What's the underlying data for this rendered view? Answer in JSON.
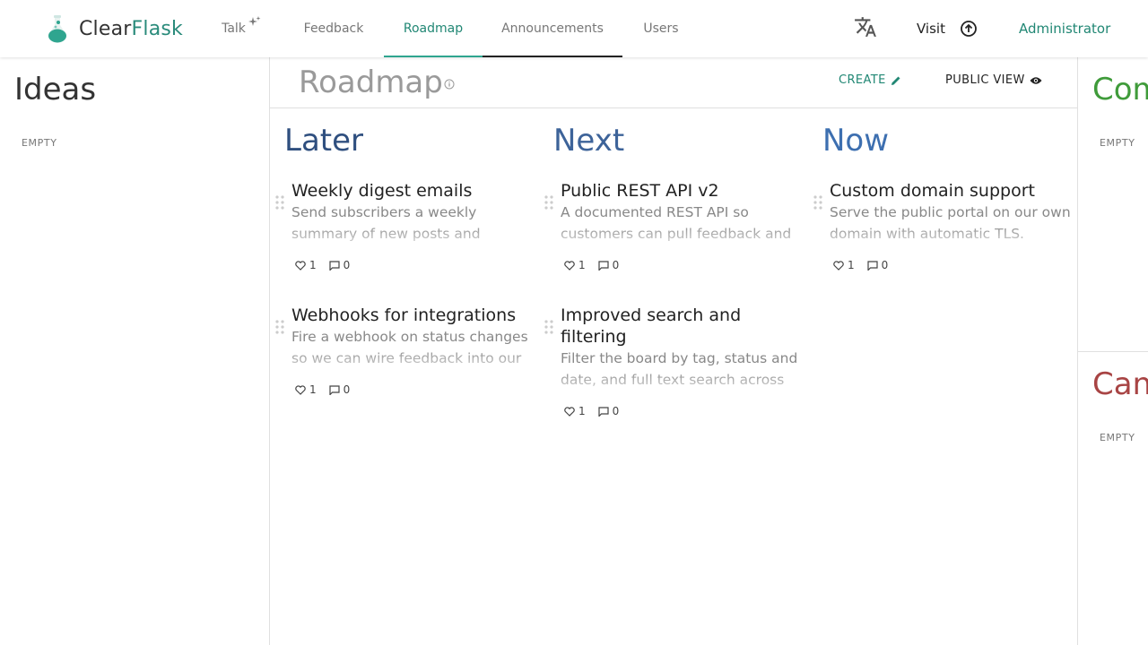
{
  "brand": {
    "part1": "Clear",
    "part2": "Flask"
  },
  "nav": {
    "tabs": [
      {
        "label": "Talk"
      },
      {
        "label": "Feedback"
      },
      {
        "label": "Roadmap"
      },
      {
        "label": "Announcements"
      },
      {
        "label": "Users"
      }
    ],
    "active": "Roadmap",
    "visit_label": "Visit",
    "account_label": "Administrator"
  },
  "ideas": {
    "title": "Ideas",
    "empty": "EMPTY"
  },
  "board": {
    "title": "Roadmap",
    "create_label": "CREATE",
    "public_view_label": "PUBLIC VIEW",
    "columns": [
      {
        "title": "Later",
        "color": "#2f4f7f",
        "cards": [
          {
            "title": "Weekly digest emails",
            "desc": "Send subscribers a weekly summary of new posts and",
            "likes": "1",
            "comments": "0"
          },
          {
            "title": "Webhooks for integrations",
            "desc": "Fire a webhook on status changes so we can wire feedback into our",
            "likes": "1",
            "comments": "0"
          }
        ]
      },
      {
        "title": "Next",
        "color": "#3d6399",
        "cards": [
          {
            "title": "Public REST API v2",
            "desc": "A documented REST API so customers can pull feedback and",
            "likes": "1",
            "comments": "0"
          },
          {
            "title": "Improved search and filtering",
            "desc": "Filter the board by tag, status and date, and full text search across",
            "likes": "1",
            "comments": "0"
          }
        ]
      },
      {
        "title": "Now",
        "color": "#3d6fb0",
        "cards": [
          {
            "title": "Custom domain support",
            "desc": "Serve the public portal on our own domain with automatic TLS.",
            "likes": "1",
            "comments": "0"
          }
        ]
      }
    ]
  },
  "completed": {
    "title": "Com",
    "empty": "EMPTY",
    "color": "#3f9b3a"
  },
  "cancelled": {
    "title": "Can",
    "empty": "EMPTY",
    "color": "#a84444"
  },
  "colors": {
    "accent": "#218774",
    "divider": "#e0e0e0"
  }
}
